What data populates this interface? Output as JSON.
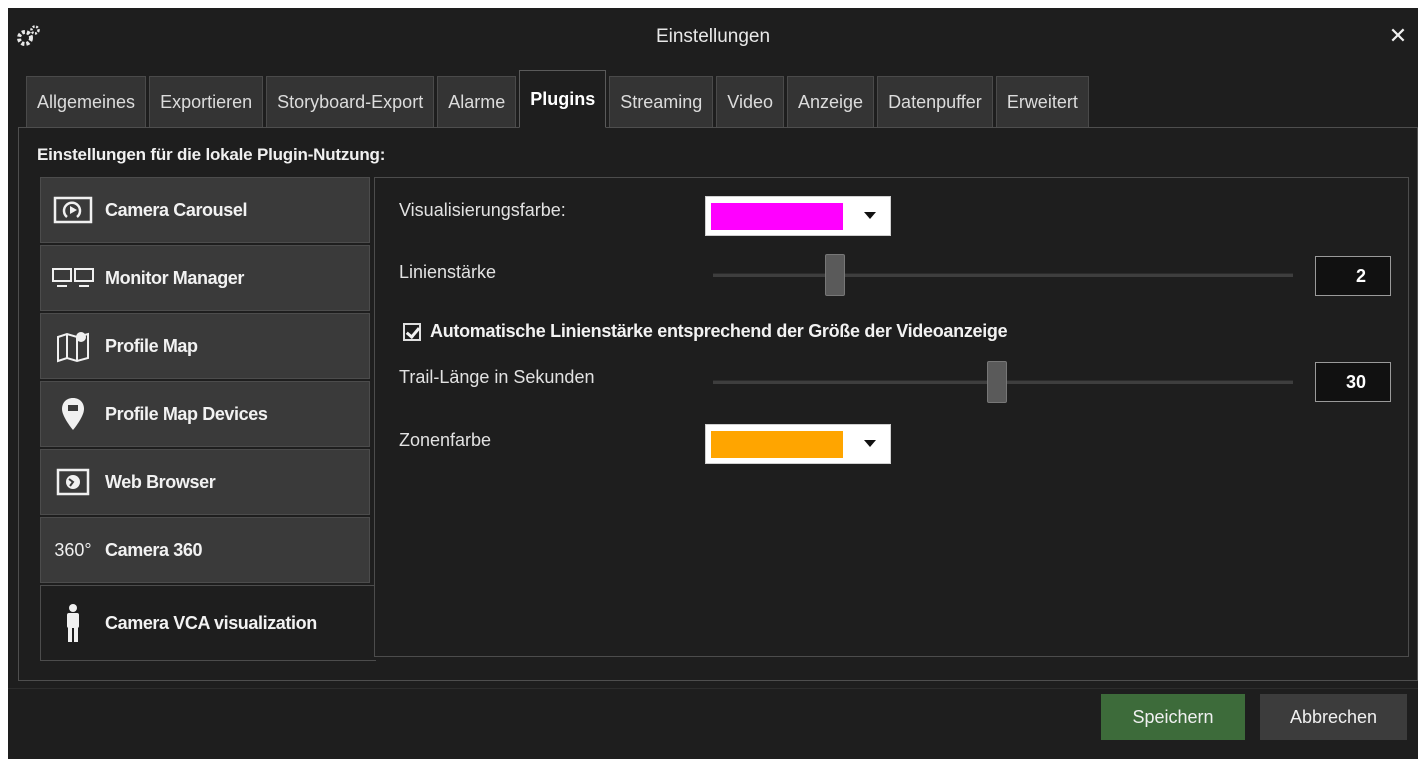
{
  "window": {
    "title": "Einstellungen",
    "close_label": "✕"
  },
  "tabs": [
    {
      "label": "Allgemeines",
      "active": false
    },
    {
      "label": "Exportieren",
      "active": false
    },
    {
      "label": "Storyboard-Export",
      "active": false
    },
    {
      "label": "Alarme",
      "active": false
    },
    {
      "label": "Plugins",
      "active": true
    },
    {
      "label": "Streaming",
      "active": false
    },
    {
      "label": "Video",
      "active": false
    },
    {
      "label": "Anzeige",
      "active": false
    },
    {
      "label": "Datenpuffer",
      "active": false
    },
    {
      "label": "Erweitert",
      "active": false
    }
  ],
  "section_title": "Einstellungen für die lokale Plugin-Nutzung:",
  "sidebar": {
    "items": [
      {
        "label": "Camera Carousel",
        "icon": "camera-carousel-icon"
      },
      {
        "label": "Monitor Manager",
        "icon": "monitor-manager-icon"
      },
      {
        "label": "Profile Map",
        "icon": "map-icon"
      },
      {
        "label": "Profile Map Devices",
        "icon": "map-pin-icon"
      },
      {
        "label": "Web Browser",
        "icon": "globe-icon"
      },
      {
        "label": "Camera 360",
        "icon": "camera-360-icon",
        "icon_text": "360°"
      },
      {
        "label": "Camera VCA visualization",
        "icon": "person-icon",
        "active": true
      }
    ]
  },
  "settings": {
    "visualization_color": {
      "label": "Visualisierungsfarbe:",
      "color": "#ff00ff"
    },
    "line_width": {
      "label": "Linienstärke",
      "value": "2",
      "slider_fraction": 0.2
    },
    "auto_line_width": {
      "label": "Automatische Linienstärke entsprechend der Größe der Videoanzeige",
      "checked": true
    },
    "trail_length": {
      "label": "Trail-Länge in Sekunden",
      "value": "30",
      "slider_fraction": 0.49
    },
    "zone_color": {
      "label": "Zonenfarbe",
      "color": "#ffa500"
    }
  },
  "buttons": {
    "save": "Speichern",
    "cancel": "Abbrechen"
  },
  "colors": {
    "accent_green": "#3d6b3a",
    "background": "#1e1e1e"
  }
}
